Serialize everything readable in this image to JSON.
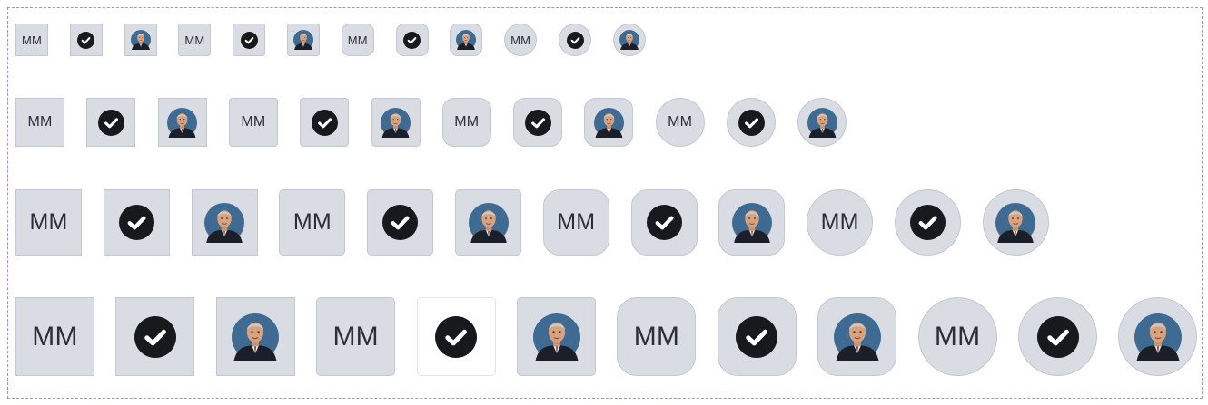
{
  "initials": "MM",
  "icon_names": {
    "check": "check-circle-icon",
    "photo": "person-photo-icon"
  },
  "colors": {
    "avatar_bg": "#dadce3",
    "avatar_border": "#c3c7d2",
    "check_circle": "#18191d",
    "check_mark": "#ffffff",
    "frame_border": "#9d8fe6"
  },
  "rows": [
    {
      "size": "xs",
      "items": [
        {
          "type": "initials",
          "shape": "square"
        },
        {
          "type": "icon",
          "shape": "square"
        },
        {
          "type": "photo",
          "shape": "square"
        },
        {
          "type": "initials",
          "shape": "rounded-sm"
        },
        {
          "type": "icon",
          "shape": "rounded-sm"
        },
        {
          "type": "photo",
          "shape": "rounded-sm"
        },
        {
          "type": "initials",
          "shape": "rounded"
        },
        {
          "type": "icon",
          "shape": "rounded"
        },
        {
          "type": "photo",
          "shape": "rounded"
        },
        {
          "type": "initials",
          "shape": "circle"
        },
        {
          "type": "icon",
          "shape": "circle"
        },
        {
          "type": "photo",
          "shape": "circle"
        }
      ]
    },
    {
      "size": "sm",
      "items": [
        {
          "type": "initials",
          "shape": "square"
        },
        {
          "type": "icon",
          "shape": "square"
        },
        {
          "type": "photo",
          "shape": "square"
        },
        {
          "type": "initials",
          "shape": "rounded-sm"
        },
        {
          "type": "icon",
          "shape": "rounded-sm"
        },
        {
          "type": "photo",
          "shape": "rounded-sm"
        },
        {
          "type": "initials",
          "shape": "rounded"
        },
        {
          "type": "icon",
          "shape": "rounded"
        },
        {
          "type": "photo",
          "shape": "rounded"
        },
        {
          "type": "initials",
          "shape": "circle"
        },
        {
          "type": "icon",
          "shape": "circle"
        },
        {
          "type": "photo",
          "shape": "circle"
        }
      ]
    },
    {
      "size": "md",
      "items": [
        {
          "type": "initials",
          "shape": "square"
        },
        {
          "type": "icon",
          "shape": "square"
        },
        {
          "type": "photo",
          "shape": "square"
        },
        {
          "type": "initials",
          "shape": "rounded-sm"
        },
        {
          "type": "icon",
          "shape": "rounded-sm"
        },
        {
          "type": "photo",
          "shape": "rounded-sm"
        },
        {
          "type": "initials",
          "shape": "rounded"
        },
        {
          "type": "icon",
          "shape": "rounded"
        },
        {
          "type": "photo",
          "shape": "rounded"
        },
        {
          "type": "initials",
          "shape": "circle"
        },
        {
          "type": "icon",
          "shape": "circle"
        },
        {
          "type": "photo",
          "shape": "circle"
        }
      ]
    },
    {
      "size": "lg",
      "items": [
        {
          "type": "initials",
          "shape": "square"
        },
        {
          "type": "icon",
          "shape": "square"
        },
        {
          "type": "photo",
          "shape": "square"
        },
        {
          "type": "initials",
          "shape": "rounded-sm"
        },
        {
          "type": "icon",
          "shape": "rounded-sm",
          "variant": "white"
        },
        {
          "type": "photo",
          "shape": "rounded-sm"
        },
        {
          "type": "initials",
          "shape": "rounded"
        },
        {
          "type": "icon",
          "shape": "rounded"
        },
        {
          "type": "photo",
          "shape": "rounded"
        },
        {
          "type": "initials",
          "shape": "circle"
        },
        {
          "type": "icon",
          "shape": "circle"
        },
        {
          "type": "photo",
          "shape": "circle"
        }
      ]
    }
  ]
}
